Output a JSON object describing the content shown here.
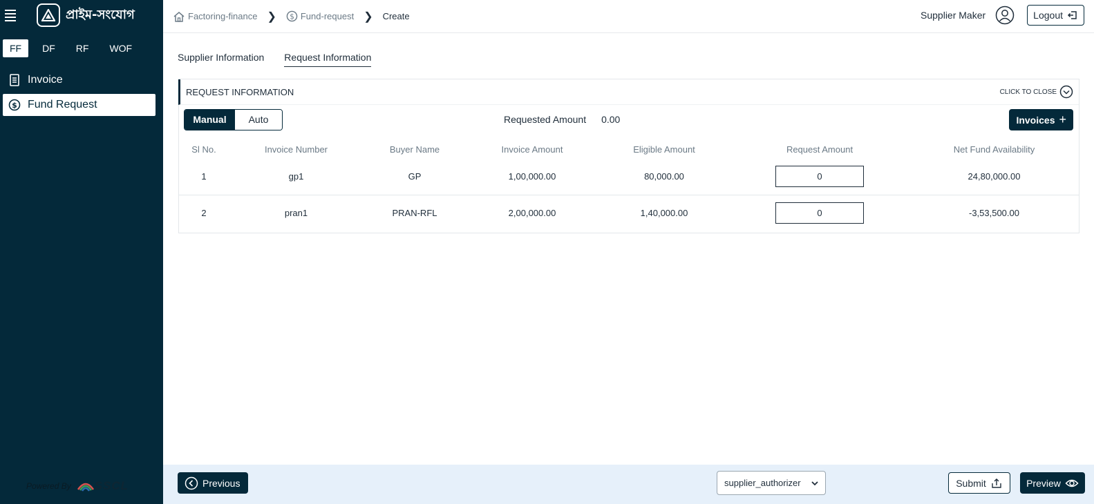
{
  "app": {
    "brand": "প্রাইম-সংযোগ"
  },
  "sidebar": {
    "module_tabs": [
      {
        "label": "FF",
        "active": true
      },
      {
        "label": "DF",
        "active": false
      },
      {
        "label": "RF",
        "active": false
      },
      {
        "label": "WOF",
        "active": false
      }
    ],
    "items": [
      {
        "label": "Invoice",
        "icon": "invoice-icon",
        "active": false
      },
      {
        "label": "Fund Request",
        "icon": "dollar-circle-icon",
        "active": true
      }
    ],
    "powered_by": "Powered By",
    "powered_brand": "SSCL"
  },
  "header": {
    "breadcrumb": [
      {
        "label": "Factoring-finance",
        "icon": "home-icon"
      },
      {
        "label": "Fund-request",
        "icon": "dollar-circle-icon"
      },
      {
        "label": "Create"
      }
    ],
    "user_name": "Supplier Maker",
    "logout_label": "Logout"
  },
  "tabs": [
    {
      "label": "Supplier Information",
      "active": false
    },
    {
      "label": "Request Information",
      "active": true
    }
  ],
  "panel": {
    "title": "REQUEST INFORMATION",
    "close_label": "CLICK TO CLOSE",
    "mode_toggle": {
      "manual": "Manual",
      "auto": "Auto",
      "selected": "Manual"
    },
    "requested_amount_label": "Requested Amount",
    "requested_amount_value": "0.00",
    "invoices_button": "Invoices"
  },
  "table": {
    "columns": [
      "Sl No.",
      "Invoice Number",
      "Buyer Name",
      "Invoice Amount",
      "Eligible Amount",
      "Request Amount",
      "Net Fund Availability"
    ],
    "rows": [
      {
        "sl": "1",
        "invoice_number": "gp1",
        "buyer": "GP",
        "invoice_amount": "1,00,000.00",
        "eligible_amount": "80,000.00",
        "request_amount": "0",
        "net_fund": "24,80,000.00"
      },
      {
        "sl": "2",
        "invoice_number": "pran1",
        "buyer": "PRAN-RFL",
        "invoice_amount": "2,00,000.00",
        "eligible_amount": "1,40,000.00",
        "request_amount": "0",
        "net_fund": "-3,53,500.00"
      }
    ]
  },
  "footer": {
    "previous_label": "Previous",
    "authorizer_selected": "supplier_authorizer",
    "submit_label": "Submit",
    "preview_label": "Preview"
  },
  "colors": {
    "sidebar_bg": "#04293a",
    "footer_bg": "#e6f0fa",
    "primary": "#04293a"
  }
}
